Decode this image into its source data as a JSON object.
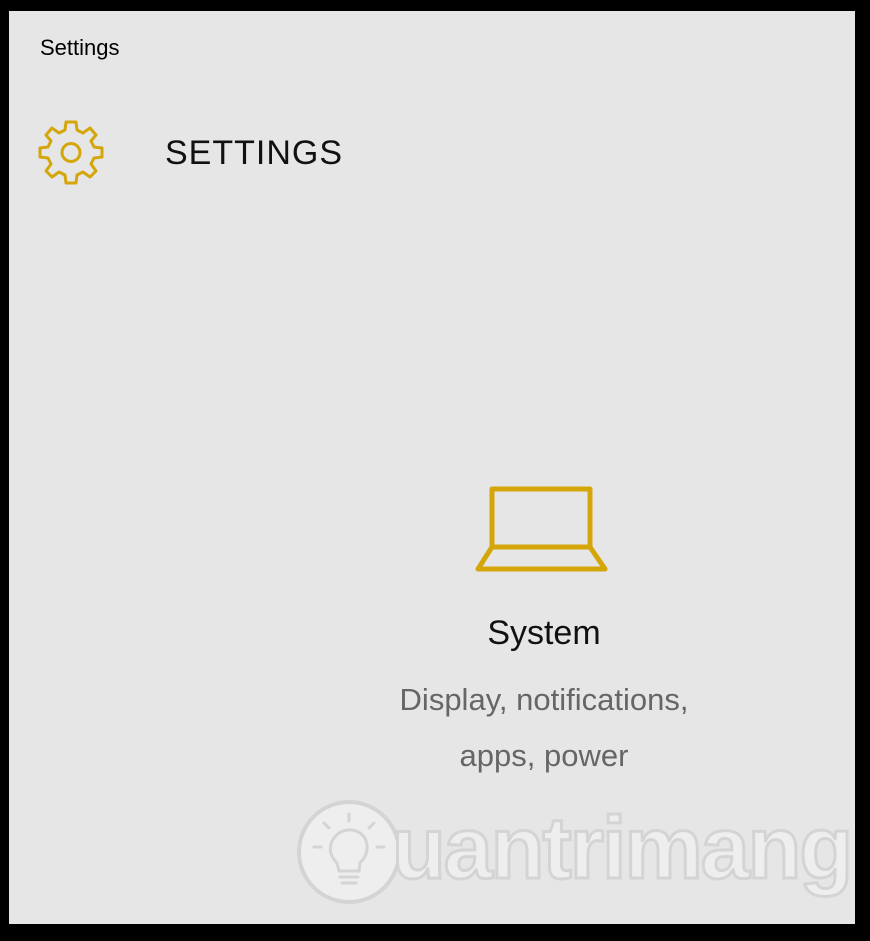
{
  "window": {
    "title": "Settings"
  },
  "header": {
    "title": "SETTINGS",
    "icon": "gear-icon"
  },
  "tiles": [
    {
      "icon": "laptop-icon",
      "title": "System",
      "description_line1": "Display, notifications,",
      "description_line2": "apps, power"
    }
  ],
  "watermark": {
    "text": "uantrimang"
  },
  "colors": {
    "accent": "#d4a60a",
    "background": "#e6e6e6",
    "frame": "#000000",
    "description": "#666666"
  }
}
